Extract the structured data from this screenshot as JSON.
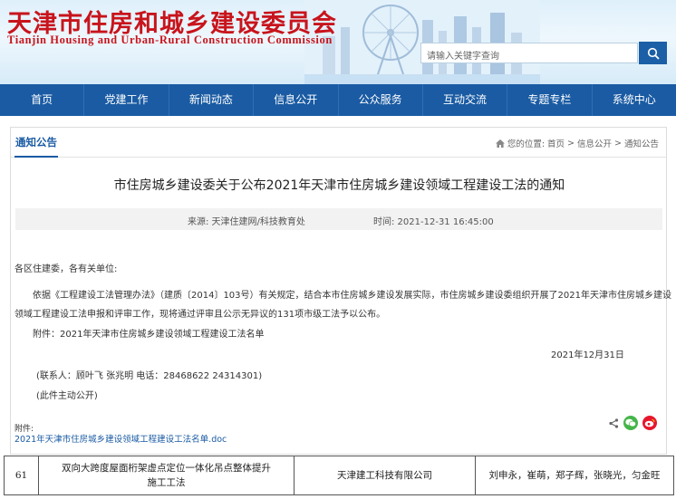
{
  "header": {
    "title": "天津市住房和城乡建设委员会",
    "subtitle": "Tianjin Housing and Urban-Rural Construction Commission",
    "search_placeholder": "请输入关键字查询",
    "search_icon": "search-icon"
  },
  "nav": {
    "items": [
      "首页",
      "党建工作",
      "新闻动态",
      "信息公开",
      "公众服务",
      "互动交流",
      "专题专栏",
      "系统中心"
    ]
  },
  "section": {
    "tab": "通知公告",
    "breadcrumb_prefix": "您的位置:",
    "breadcrumb": [
      "首页",
      ">",
      "信息公开",
      ">",
      "通知公告"
    ]
  },
  "article": {
    "title": "市住房城乡建设委关于公布2021年天津市住房城乡建设领域工程建设工法的通知",
    "source": "来源:  天津住建网/科技教育处",
    "time": "时间:  2021-12-31 16:45:00",
    "greeting": "各区住建委，各有关单位:",
    "para1_line1": "依据《工程建设工法管理办法》（建质〔2014〕103号）有关规定，结合本市住房城乡建设发展实际，市住房城乡建设委组织开展了2021年天津市住房城乡建设",
    "para1_line2": "领域工程建设工法申报和评审工作，现将通过评审且公示无异议的131项市级工法予以公布。",
    "attachment_note": "附件：2021年天津市住房城乡建设领域工程建设工法名单",
    "date": "2021年12月31日",
    "contact": "(联系人：顾叶飞  张兆明 电话：28468622 24314301)",
    "disclosure": "(此件主动公开)",
    "attach_label": "附件:",
    "attach_file": "2021年天津市住房城乡建设领域工程建设工法名单.doc"
  },
  "share": {
    "icons": [
      "share-icon",
      "wechat-icon",
      "weibo-icon"
    ],
    "wechat_color": "#44b549",
    "weibo_color": "#e6162d"
  },
  "table_row": {
    "no": "61",
    "name_line1": "双向大跨度屋面桁架虚点定位一体化吊点整体提升",
    "name_line2": "施工工法",
    "company": "天津建工科技有限公司",
    "people": "刘申永，崔萌，郑子辉，张晓光，匀金旺"
  },
  "colors": {
    "brand_blue": "#1a5ba3",
    "title_red": "#c8141c"
  }
}
